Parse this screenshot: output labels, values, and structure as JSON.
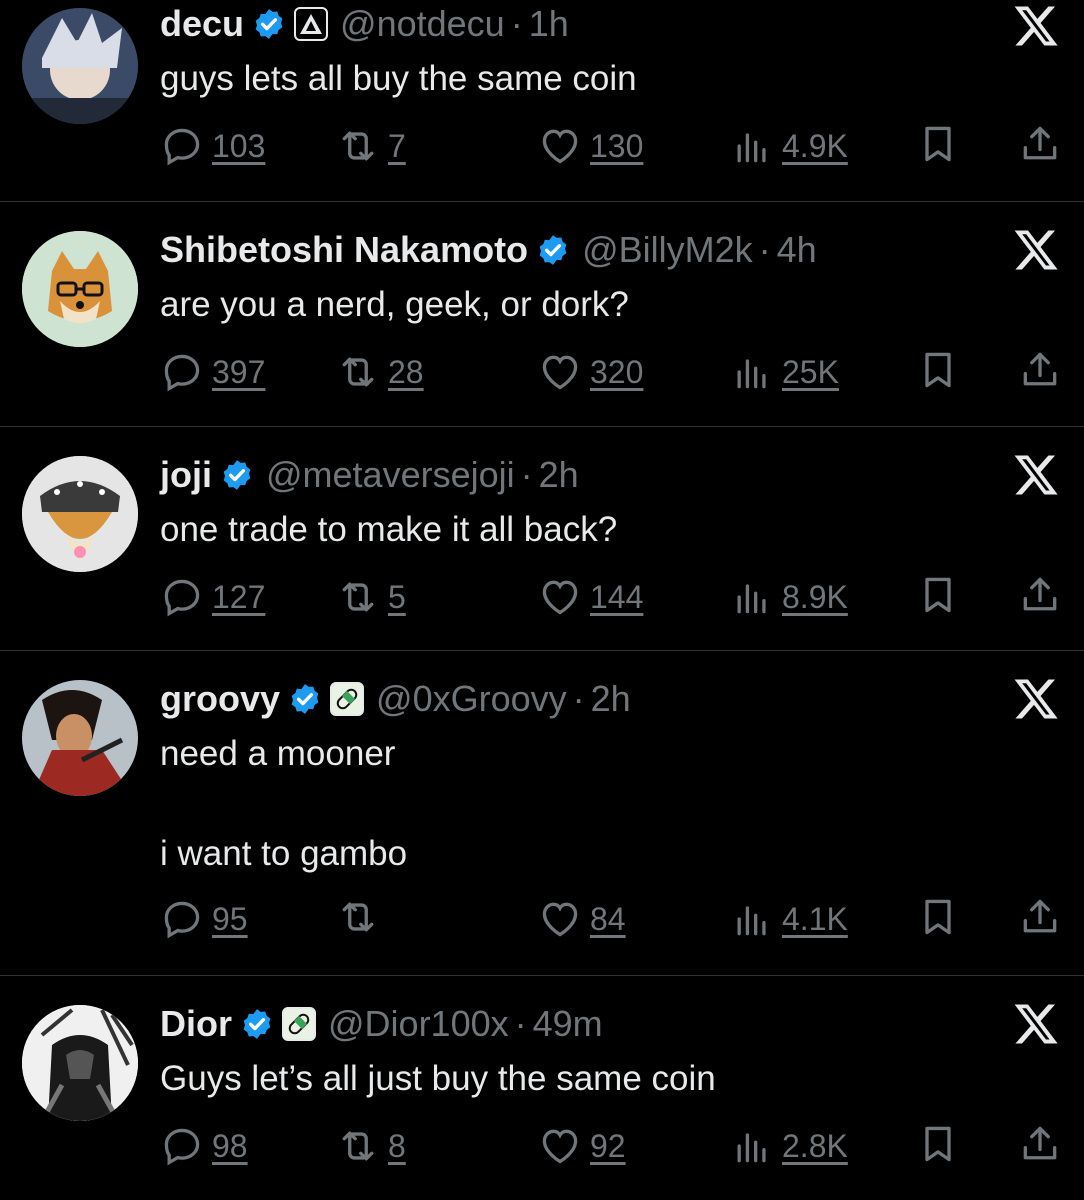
{
  "tweets": [
    {
      "name": "decu",
      "handle": "@notdecu",
      "dot": "·",
      "time": "1h",
      "text": "guys lets all buy the same coin",
      "replies": "103",
      "retweets": "7",
      "likes": "130",
      "views": "4.9K",
      "affiliate_icon": "triangle-badge-icon"
    },
    {
      "name": "Shibetoshi Nakamoto",
      "handle": "@BillyM2k",
      "dot": "·",
      "time": "4h",
      "text": "are you a nerd, geek, or dork?",
      "replies": "397",
      "retweets": "28",
      "likes": "320",
      "views": "25K"
    },
    {
      "name": "joji",
      "handle": "@metaversejoji",
      "dot": "·",
      "time": "2h",
      "text": "one trade to make it all back?",
      "replies": "127",
      "retweets": "5",
      "likes": "144",
      "views": "8.9K"
    },
    {
      "name": "groovy",
      "handle": "@0xGroovy",
      "dot": "·",
      "time": "2h",
      "text": "need a mooner\n\ni want to gambo",
      "replies": "95",
      "retweets": "",
      "likes": "84",
      "views": "4.1K",
      "affiliate_icon": "pill-badge-icon"
    },
    {
      "name": "Dior",
      "handle": "@Dior100x",
      "dot": "·",
      "time": "49m",
      "text": "Guys let’s all just buy the same coin",
      "replies": "98",
      "retweets": "8",
      "likes": "92",
      "views": "2.8K",
      "affiliate_icon": "pill-badge-icon"
    }
  ],
  "colors": {
    "background": "#000000",
    "text": "#e7e9ea",
    "muted": "#71767b",
    "verified": "#1d9bf0",
    "divider": "#2f3336"
  }
}
